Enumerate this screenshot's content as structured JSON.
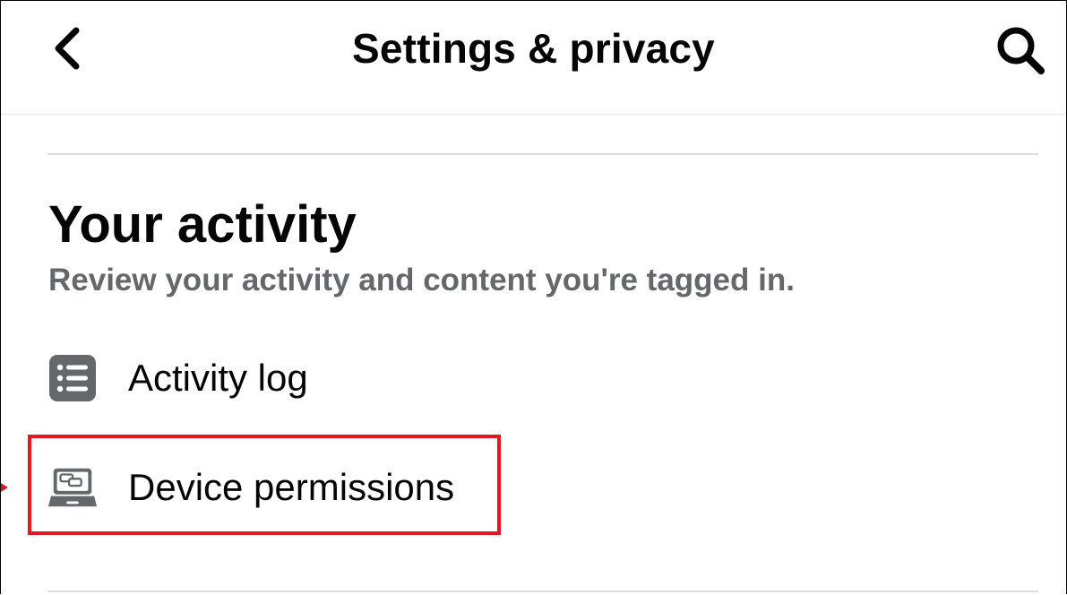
{
  "header": {
    "title": "Settings & privacy",
    "back_icon": "chevron-left-icon",
    "search_icon": "search-icon"
  },
  "section": {
    "title": "Your activity",
    "subtitle": "Review your activity and content you're tagged in."
  },
  "items": [
    {
      "label": "Activity log",
      "icon": "list-icon"
    },
    {
      "label": "Device permissions",
      "icon": "laptop-icon"
    }
  ],
  "annotation": {
    "highlight_color": "#e8171d",
    "highlighted_item": "Device permissions"
  },
  "colors": {
    "text_primary": "#050505",
    "text_secondary": "#65676b",
    "icon_gray": "#65676b",
    "divider": "#dadde1"
  }
}
